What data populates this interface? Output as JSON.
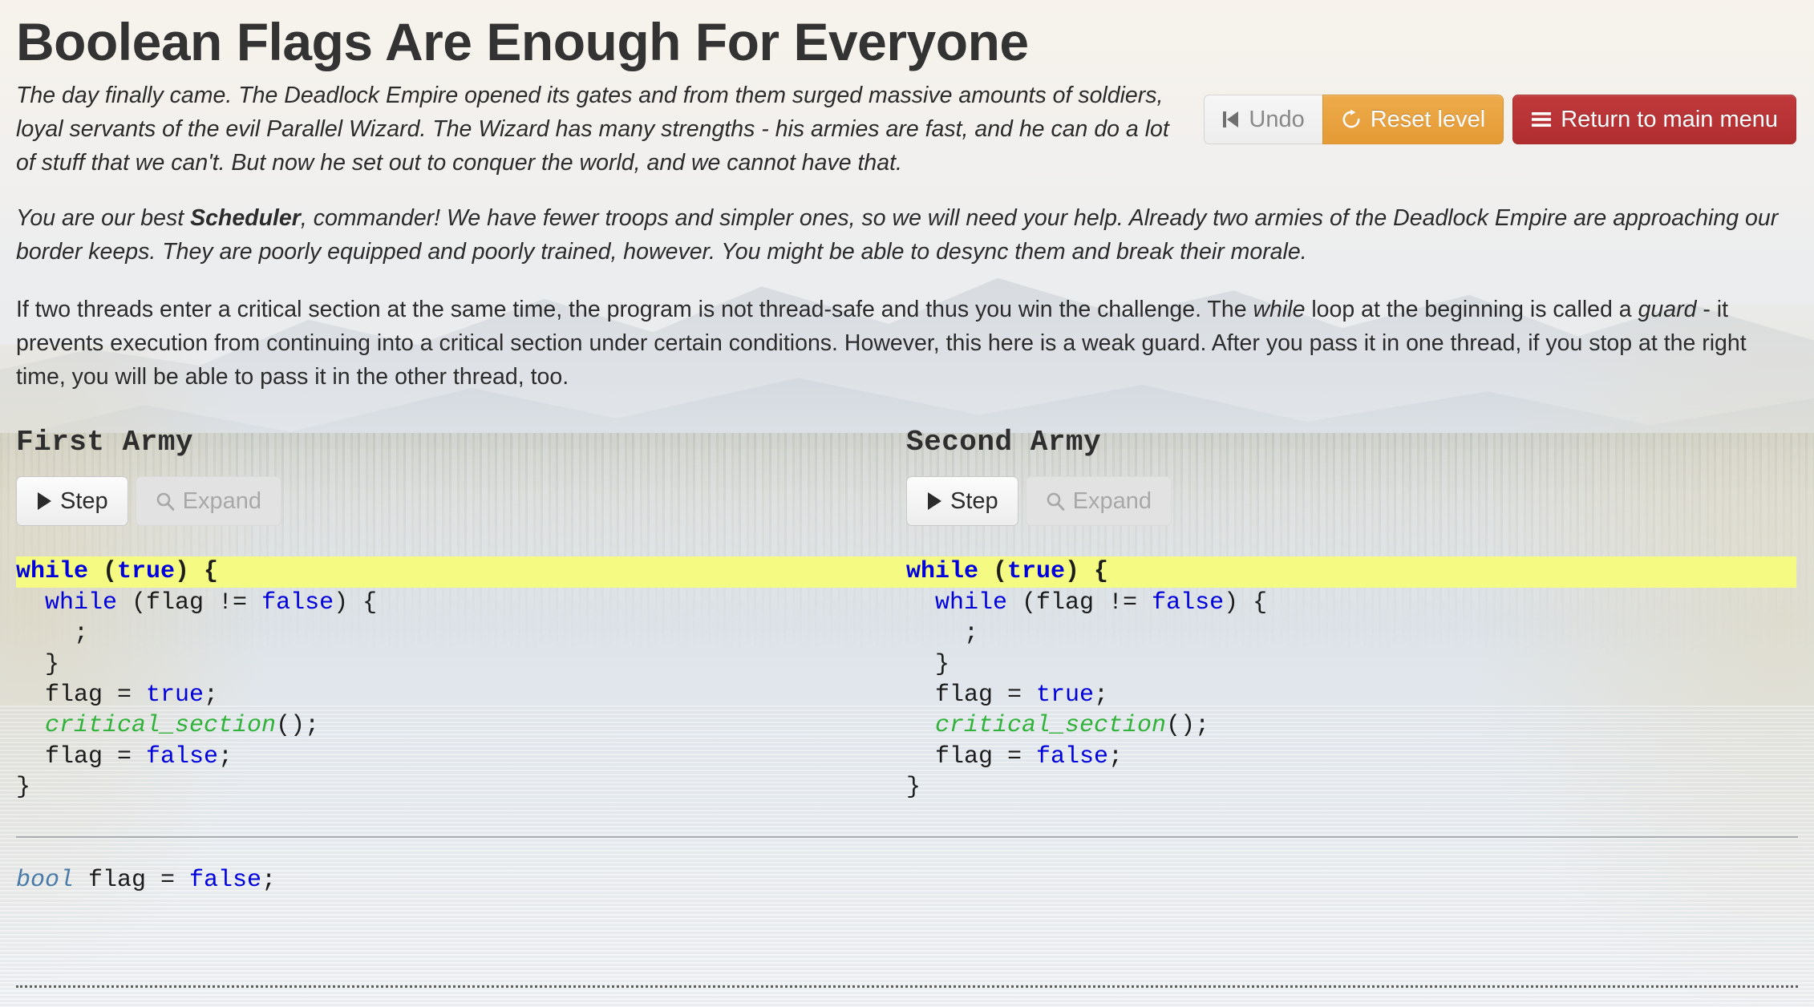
{
  "page": {
    "title": "Boolean Flags Are Enough For Everyone"
  },
  "toolbar": {
    "undo_label": "Undo",
    "undo_icon": "step-backward-icon",
    "reset_label": "Reset level",
    "reset_icon": "refresh-icon",
    "menu_label": "Return to main menu",
    "menu_icon": "hamburger-icon",
    "colors": {
      "reset_bg": "#e49a35",
      "menu_bg": "#b02e30",
      "undo_text": "#888888"
    }
  },
  "story": {
    "paragraph1": "The day finally came. The Deadlock Empire opened its gates and from them surged massive amounts of soldiers, loyal servants of the evil Parallel Wizard. The Wizard has many strengths - his armies are fast, and he can do a lot of stuff that we can't. But now he set out to conquer the world, and we cannot have that.",
    "paragraph2_part1": "You are our best ",
    "paragraph2_bold": "Scheduler",
    "paragraph2_part2": ", commander! We have fewer troops and simpler ones, so we will need your help. Already two armies of the Deadlock Empire are approaching our border keeps. They are poorly equipped and poorly trained, however. You might be able to desync them and break their morale.",
    "explain_part1": "If two threads enter a critical section at the same time, the program is not thread-safe and thus you win the challenge. The ",
    "explain_em1": "while",
    "explain_part2": " loop at the beginning is called a ",
    "explain_em2": "guard",
    "explain_part3": " - it prevents execution from continuing into a critical section under certain conditions. However, this here is a weak guard. After you pass it in one thread, if you stop at the right time, you will be able to pass it in the other thread, too."
  },
  "threads": [
    {
      "title": "First Army",
      "step_label": "Step",
      "step_icon": "play-icon",
      "expand_label": "Expand",
      "expand_icon": "search-icon",
      "expand_disabled": true,
      "code_lines": [
        "while (true) {",
        "  while (flag != false) {",
        "    ;",
        "  }",
        "  flag = true;",
        "  critical_section();",
        "  flag = false;",
        "}"
      ],
      "highlighted_line": 0
    },
    {
      "title": "Second Army",
      "step_label": "Step",
      "step_icon": "play-icon",
      "expand_label": "Expand",
      "expand_icon": "search-icon",
      "expand_disabled": true,
      "code_lines": [
        "while (true) {",
        "  while (flag != false) {",
        "    ;",
        "  }",
        "  flag = true;",
        "  critical_section();",
        "  flag = false;",
        "}"
      ],
      "highlighted_line": 0
    }
  ],
  "declarations": {
    "type": "bool",
    "text_mid": " flag = ",
    "value": "false",
    "terminator": ";"
  },
  "syntax_colors": {
    "keyword": "#0000dd",
    "function": "#31b23a",
    "type": "#4a7ba8",
    "highlight": "#f4fa82",
    "plain": "#1c1c1c"
  }
}
